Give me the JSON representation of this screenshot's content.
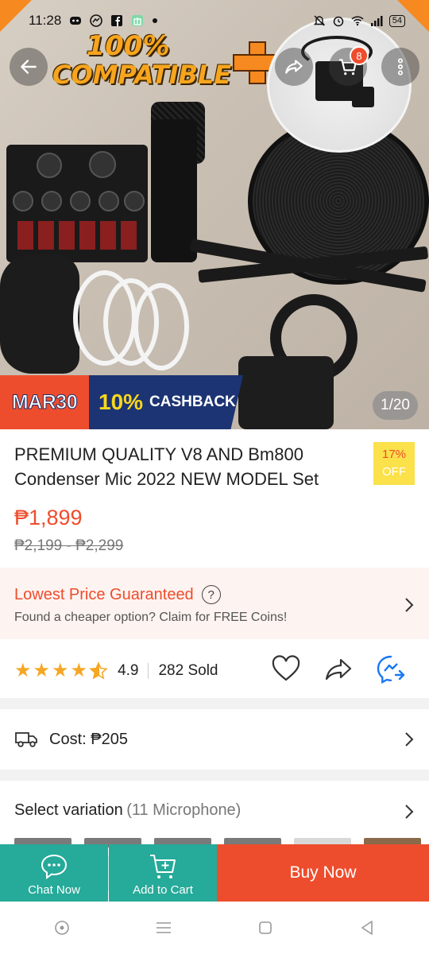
{
  "status_bar": {
    "time": "11:28",
    "battery": "54",
    "notification_icons": [
      "discord-icon",
      "messenger-icon",
      "facebook-icon",
      "gift-icon",
      "dot-icon"
    ],
    "system_icons": [
      "mute-icon",
      "alarm-icon",
      "wifi-icon",
      "signal-icon",
      "battery-icon"
    ]
  },
  "hero": {
    "banner_line1": "100%",
    "banner_line2": "COMPATIBLE",
    "cart_count": "8",
    "promo_date": "MAR30",
    "promo_percent": "10%",
    "promo_word": "CASHBACK",
    "image_counter": "1/20",
    "accent": "#f6891f"
  },
  "product": {
    "title": "PREMIUM QUALITY V8 AND Bm800 Condenser Mic 2022 NEW MODEL Set",
    "discount_line1": "17%",
    "discount_line2": "OFF",
    "price": "₱1,899",
    "original_price": "₱2,199 - ₱2,299"
  },
  "guarantee": {
    "title": "Lowest Price Guaranteed",
    "help_symbol": "?",
    "subtitle": "Found a cheaper option? Claim for FREE Coins!"
  },
  "rating": {
    "score": "4.9",
    "score_value": 4.9,
    "sold": "282 Sold"
  },
  "shipping": {
    "label": "Cost: ₱205"
  },
  "variation": {
    "label": "Select variation",
    "count": "(11 Microphone)"
  },
  "bottom_bar": {
    "chat_label": "Chat Now",
    "cart_label": "Add to Cart",
    "buy_label": "Buy Now"
  },
  "colors": {
    "brand": "#ee4d2d",
    "teal": "#26aa99",
    "star": "#f5a623",
    "messenger": "#1877f2"
  }
}
